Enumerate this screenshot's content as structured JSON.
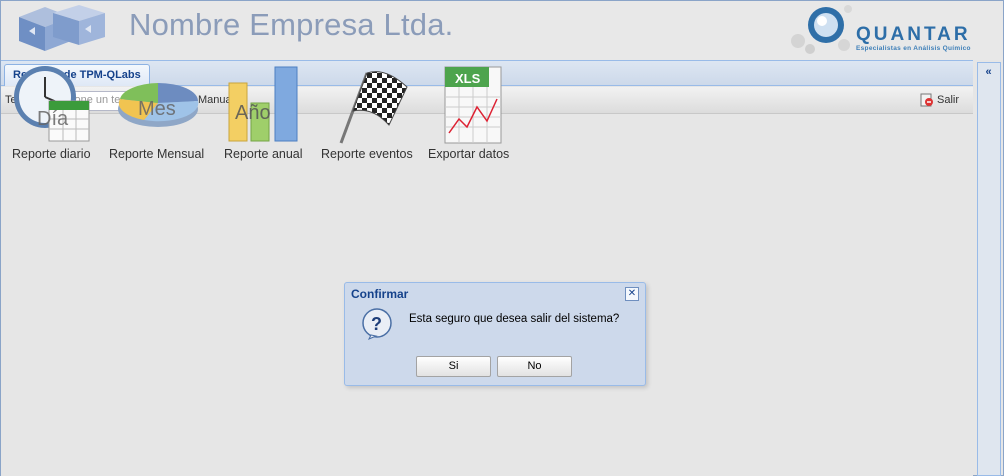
{
  "header": {
    "company_name": "Nombre Empresa Ltda.",
    "brand_name": "QUANTAR",
    "brand_tagline": "Especialistas en Análisis Químico"
  },
  "tabs": [
    {
      "label": "Reportes de TPM-QLabs",
      "active": true
    }
  ],
  "toolbar": {
    "tema_label": "Tema",
    "tema_placeholder": "Seleccione un tema",
    "manual_label": "Manual",
    "salir_label": "Salir"
  },
  "collapse_label": "«",
  "icons": [
    {
      "label": "Reporte diario",
      "overlay": "Día",
      "icon": "clock-calendar-icon"
    },
    {
      "label": "Reporte Mensual",
      "overlay": "Mes",
      "icon": "pie-chart-icon"
    },
    {
      "label": "Reporte anual",
      "overlay": "Año",
      "icon": "bar-chart-icon"
    },
    {
      "label": "Reporte eventos",
      "overlay": "",
      "icon": "checkered-flag-icon"
    },
    {
      "label": "Exportar datos",
      "overlay": "XLS",
      "icon": "xls-file-icon"
    }
  ],
  "dialog": {
    "title": "Confirmar",
    "message": "Esta seguro que desea salir del sistema?",
    "yes_label": "Si",
    "no_label": "No",
    "close_glyph": "✕"
  }
}
